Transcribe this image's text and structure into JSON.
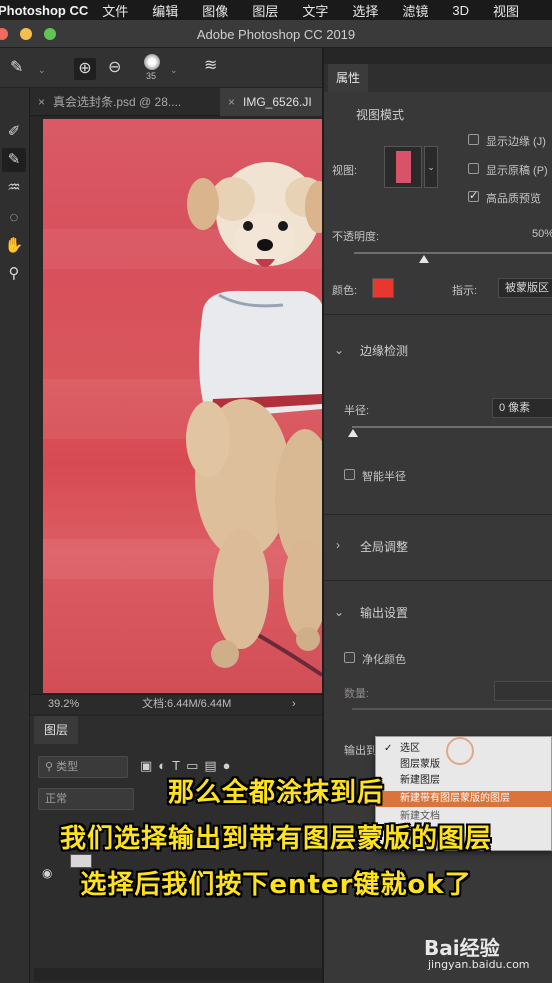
{
  "menubar": {
    "app_name": "Photoshop CC",
    "items": [
      "文件",
      "编辑",
      "图像",
      "图层",
      "文字",
      "选择",
      "滤镜",
      "3D",
      "视图"
    ]
  },
  "window": {
    "title": "Adobe Photoshop CC 2019"
  },
  "options_bar": {
    "brush_size": "35"
  },
  "tabs": [
    {
      "label": "真会选封条.psd @ 28...."
    },
    {
      "label": "IMG_6526.JI"
    }
  ],
  "status": {
    "zoom": "39.2%",
    "doc_size": "文档:6.44M/6.44M",
    "arrow": "›"
  },
  "layers": {
    "tab_label": "图层",
    "filter_placeholder": "类型",
    "blend_mode": "正常"
  },
  "properties": {
    "tab_label": "属性",
    "view_mode_title": "视图模式",
    "view_label": "视图:",
    "show_edge": "显示边缘 (J)",
    "show_original": "显示原稿 (P)",
    "high_quality": "高品质预览",
    "opacity_label": "不透明度:",
    "opacity_value": "50%",
    "opacity_fraction": 0.5,
    "color_label": "颜色:",
    "color_swatch": "#e8372f",
    "indicate_label": "指示:",
    "indicate_value": "被蒙版区",
    "edge_detection_title": "边缘检测",
    "radius_label": "半径:",
    "radius_value": "0 像素",
    "smart_radius": "智能半径",
    "global_adjust_title": "全局调整",
    "output_settings_title": "输出设置",
    "decontaminate": "净化颜色",
    "amount_label": "数量:",
    "output_to_label": "输出到"
  },
  "output_dropdown": {
    "items": [
      {
        "label": "选区",
        "checked": true,
        "highlighted": false
      },
      {
        "label": "图层蒙版",
        "checked": false,
        "highlighted": false
      },
      {
        "label": "新建图层",
        "checked": false,
        "highlighted": false
      },
      {
        "label": "新建带有图层蒙版的图层",
        "checked": false,
        "highlighted": true
      },
      {
        "label": "新建文档",
        "checked": false,
        "highlighted": false
      }
    ]
  },
  "subtitles": {
    "line1": "那么全都涂抹到后",
    "line2": "我们选择输出到带有图层蒙版的图层",
    "line3": "选择后我们按下enter键就ok了"
  },
  "watermark": {
    "brand_text": "Bai经验",
    "url": "jingyan.baidu.com"
  },
  "colors": {
    "canvas_red": "#d8525c",
    "highlight": "#d8743c",
    "subtitle": "#ffe21f"
  }
}
